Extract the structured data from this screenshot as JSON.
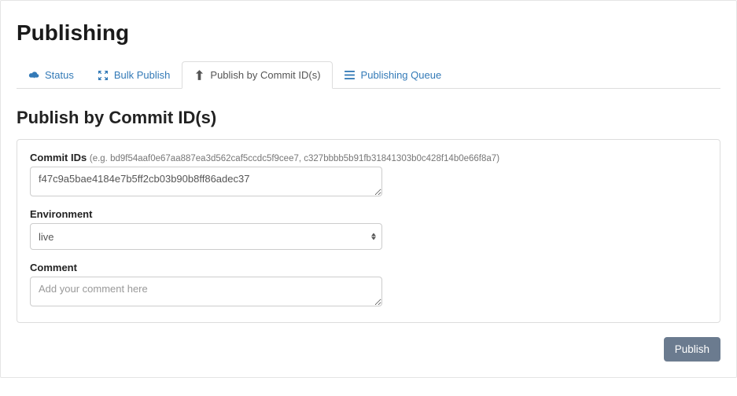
{
  "page": {
    "title": "Publishing"
  },
  "tabs": {
    "status": {
      "label": "Status"
    },
    "bulk_publish": {
      "label": "Bulk Publish"
    },
    "publish_by_commit": {
      "label": "Publish by Commit ID(s)"
    },
    "publishing_queue": {
      "label": "Publishing Queue"
    }
  },
  "section": {
    "heading": "Publish by Commit ID(s)"
  },
  "form": {
    "commit_ids": {
      "label": "Commit IDs",
      "hint": "(e.g. bd9f54aaf0e67aa887ea3d562caf5ccdc5f9cee7, c327bbbb5b91fb31841303b0c428f14b0e66f8a7)",
      "value": "f47c9a5bae4184e7b5ff2cb03b90b8ff86adec37"
    },
    "environment": {
      "label": "Environment",
      "value": "live"
    },
    "comment": {
      "label": "Comment",
      "placeholder": "Add your comment here",
      "value": ""
    }
  },
  "actions": {
    "publish": "Publish"
  }
}
